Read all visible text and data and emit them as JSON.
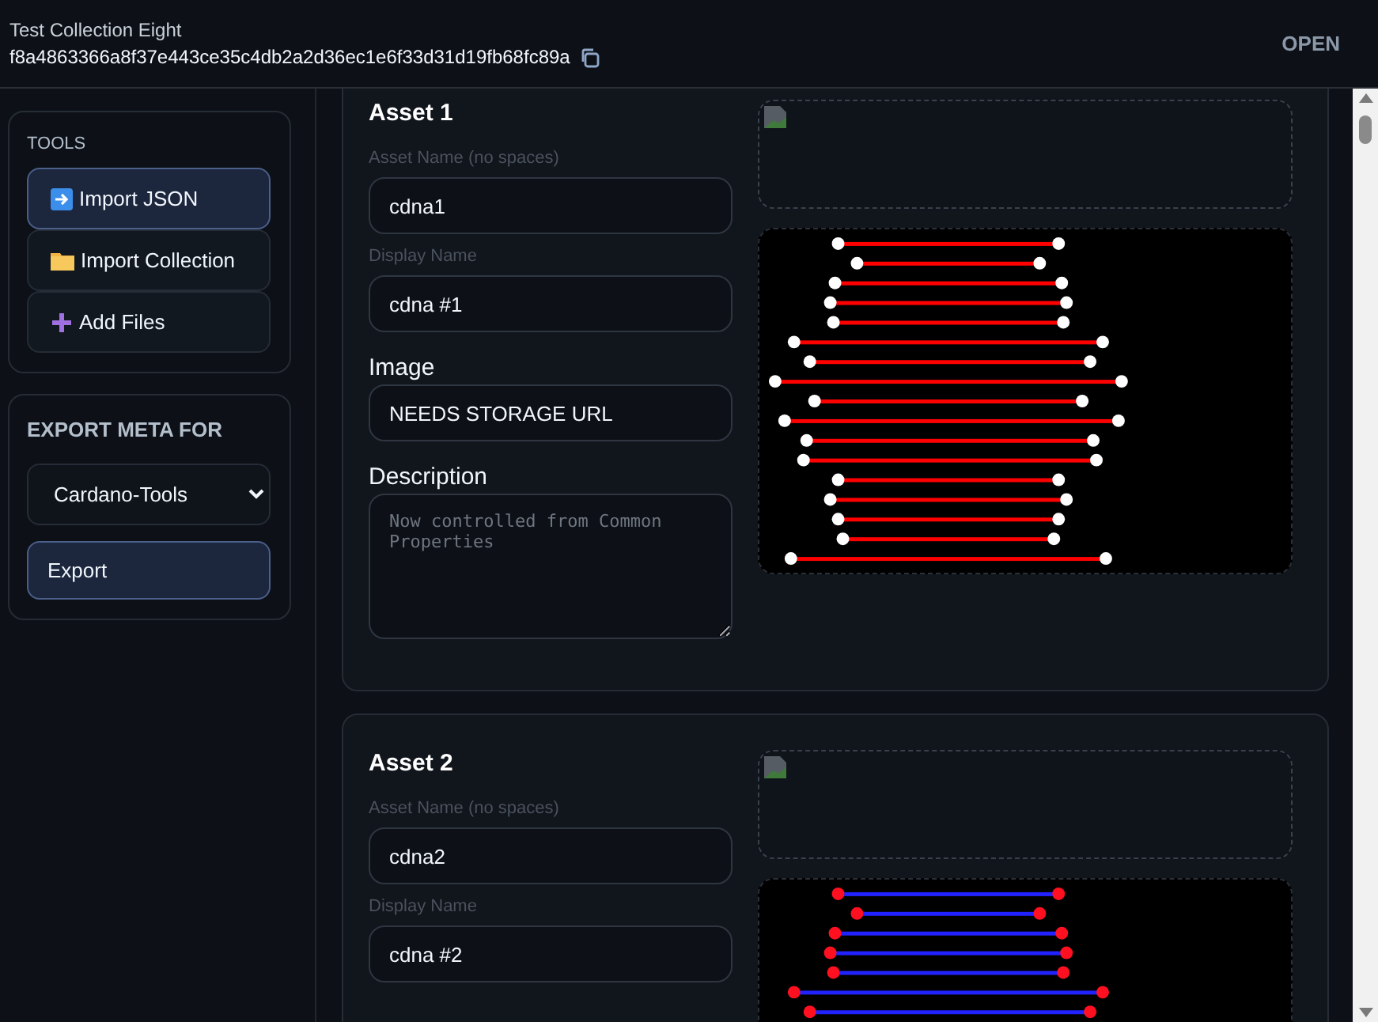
{
  "header": {
    "title": "Test Collection Eight",
    "hash": "f8a4863366a8f37e443ce35c4db2a2d36ec1e6f33d31d19fb68fc89a",
    "open_button": "OPEN"
  },
  "tools": {
    "heading": "TOOLS",
    "buttons": [
      {
        "label": "Import JSON",
        "kind": "json",
        "selected": true
      },
      {
        "label": "Import Collection",
        "kind": "folder",
        "selected": false
      },
      {
        "label": "Add Files",
        "kind": "plus",
        "selected": false
      }
    ]
  },
  "export": {
    "heading": "EXPORT META FOR",
    "format": "Cardano-Tools",
    "button": "Export"
  },
  "assets": [
    {
      "title": "Asset 1",
      "fields": [
        {
          "kind": "hint",
          "label": "Asset Name (no spaces)",
          "value": "cdna1"
        },
        {
          "kind": "hint",
          "label": "Display Name",
          "value": "cdna #1"
        },
        {
          "kind": "main",
          "label": "Image",
          "value": "NEEDS STORAGE URL"
        },
        {
          "kind": "textarea",
          "label": "Description",
          "placeholder": "Now controlled from Common Properties"
        }
      ]
    },
    {
      "title": "Asset 2",
      "fields": [
        {
          "kind": "hint",
          "label": "Asset Name (no spaces)",
          "value": "cdna2"
        },
        {
          "kind": "hint",
          "label": "Display Name",
          "value": "cdna #2"
        }
      ]
    }
  ]
}
